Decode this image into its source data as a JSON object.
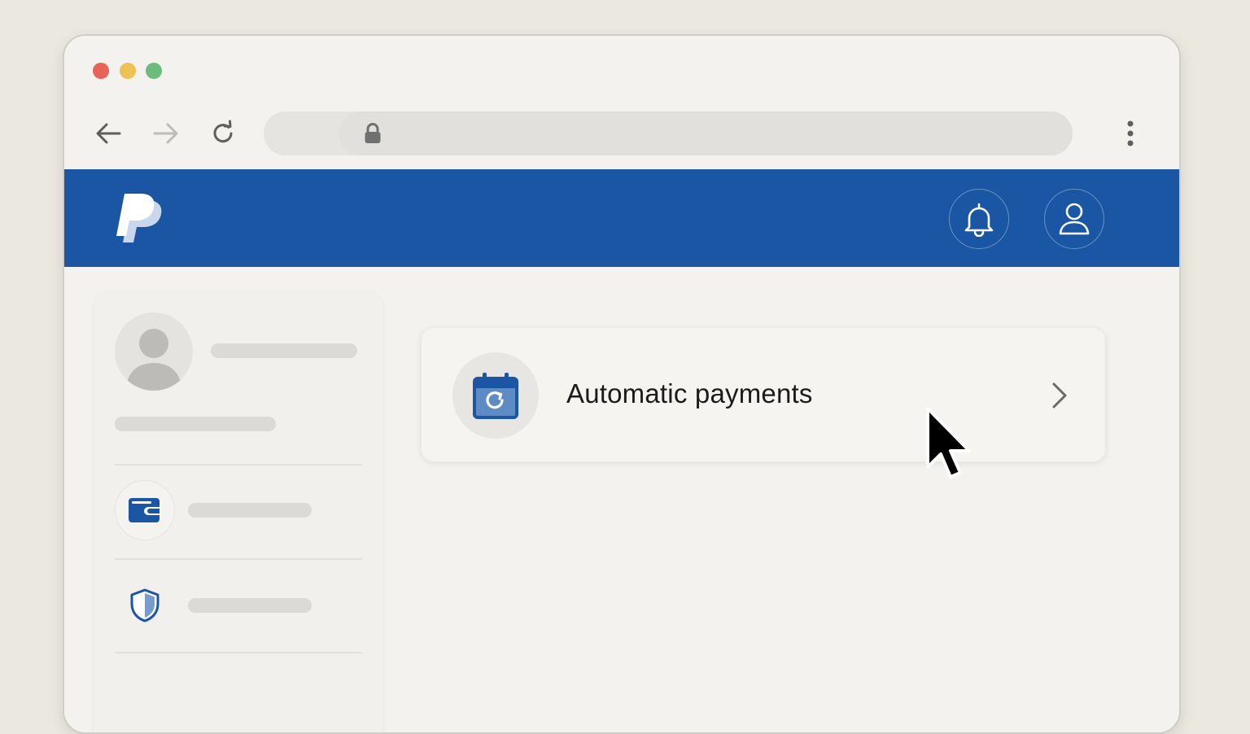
{
  "window": {
    "controls": [
      "close",
      "minimize",
      "maximize"
    ]
  },
  "browser": {
    "nav": {
      "back_icon": "arrow-left-icon",
      "forward_icon": "arrow-right-icon",
      "reload_icon": "reload-icon"
    },
    "address_bar": {
      "secure_icon": "lock-icon",
      "url": ""
    },
    "menu_icon": "kebab-menu-icon"
  },
  "app_header": {
    "brand_logo": "paypal-logo",
    "notifications_icon": "bell-icon",
    "account_icon": "user-icon",
    "colors": {
      "header_bg": "#1a56a4",
      "accent": "#1a56a4"
    }
  },
  "sidebar": {
    "profile": {
      "avatar_icon": "avatar-placeholder-icon",
      "name": "",
      "subtitle": ""
    },
    "items": [
      {
        "icon": "wallet-icon",
        "label": ""
      },
      {
        "icon": "shield-icon",
        "label": ""
      }
    ]
  },
  "main": {
    "card": {
      "icon": "calendar-refresh-icon",
      "title": "Automatic payments",
      "chevron_icon": "chevron-right-icon"
    }
  },
  "cursor": "pointer-cursor-icon"
}
